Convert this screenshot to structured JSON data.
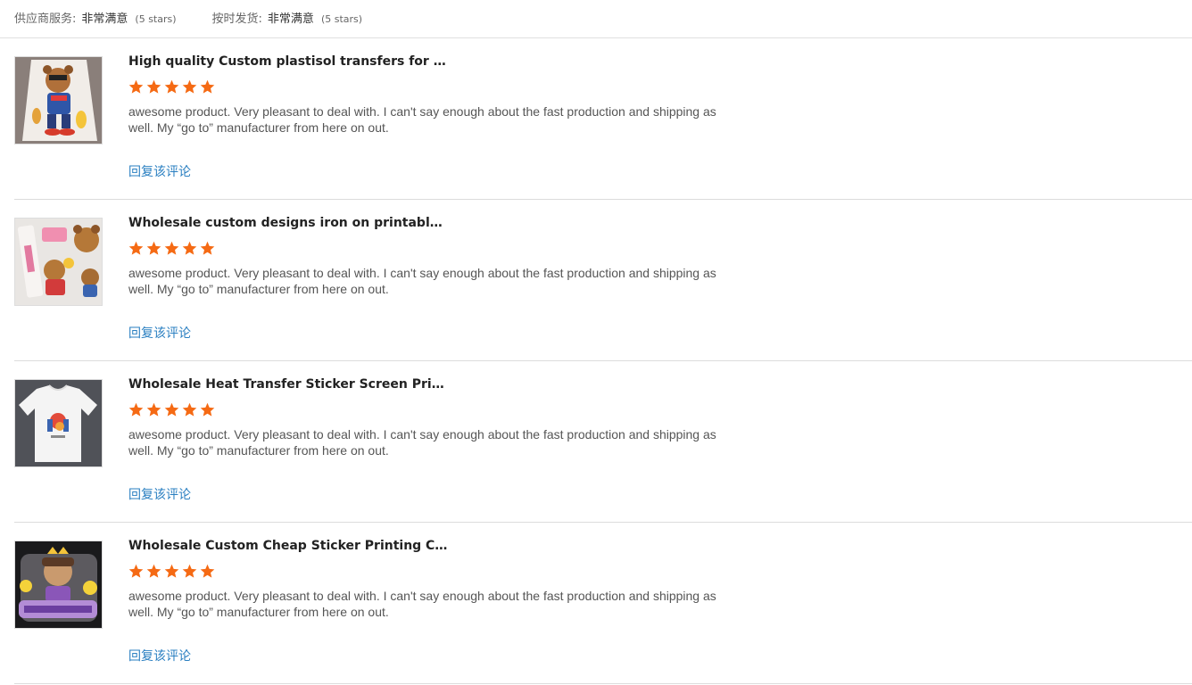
{
  "summary": {
    "supplier_service_label": "供应商服务:",
    "supplier_service_value": "非常满意",
    "supplier_service_stars": "(5 stars)",
    "on_time_label": "按时发货:",
    "on_time_value": "非常满意",
    "on_time_stars": "(5 stars)"
  },
  "colors": {
    "star": "#f56a14",
    "reply_link": "#2a7fc1",
    "divider": "#dcdcdc"
  },
  "reviews": [
    {
      "title": "High quality Custom plastisol transfers for Clot...",
      "rating": 5,
      "comment": "awesome product. Very pleasant to deal with. I can't say enough about the fast production and shipping as well. My “go to” manufacturer from here on out.",
      "reply": "回复该评论",
      "image": "bear-transfer-thumbnail"
    },
    {
      "title": "Wholesale custom designs iron on printable pl...",
      "rating": 5,
      "comment": "awesome product. Very pleasant to deal with. I can't say enough about the fast production and shipping as well. My “go to” manufacturer from here on out.",
      "reply": "回复该评论",
      "image": "bear-stickers-thumbnail"
    },
    {
      "title": "Wholesale Heat Transfer Sticker Screen Print V...",
      "rating": 5,
      "comment": "awesome product. Very pleasant to deal with. I can't say enough about the fast production and shipping as well. My “go to” manufacturer from here on out.",
      "reply": "回复该评论",
      "image": "tshirt-thumbnail"
    },
    {
      "title": "Wholesale Custom Cheap Sticker Printing Com...",
      "rating": 5,
      "comment": "awesome product. Very pleasant to deal with. I can't say enough about the fast production and shipping as well. My “go to” manufacturer from here on out.",
      "reply": "回复该评论",
      "image": "still-i-rise-sticker-thumbnail"
    }
  ]
}
